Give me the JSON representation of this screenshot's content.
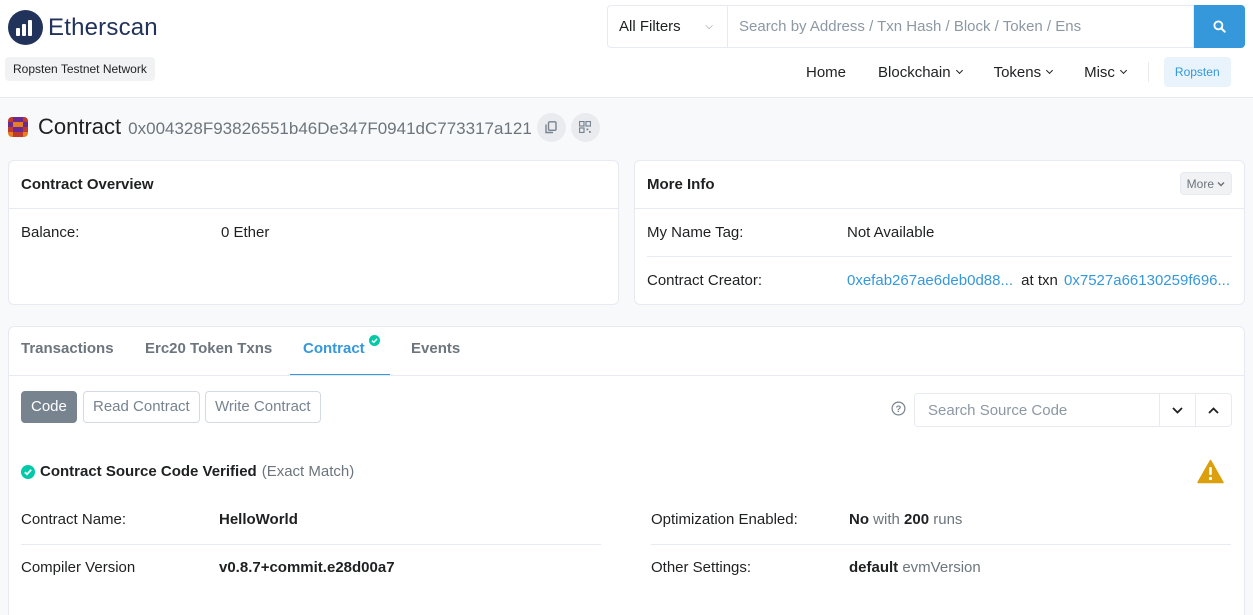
{
  "brand": {
    "name": "Etherscan",
    "network_badge": "Ropsten Testnet Network"
  },
  "search": {
    "filter_label": "All Filters",
    "placeholder": "Search by Address / Txn Hash / Block / Token / Ens"
  },
  "nav": {
    "items": [
      {
        "label": "Home",
        "dropdown": false
      },
      {
        "label": "Blockchain",
        "dropdown": true
      },
      {
        "label": "Tokens",
        "dropdown": true
      },
      {
        "label": "Misc",
        "dropdown": true
      }
    ],
    "network_button": "Ropsten"
  },
  "page": {
    "title": "Contract",
    "address": "0x004328F93826551b46De347F0941dC773317a121"
  },
  "overview": {
    "title": "Contract Overview",
    "balance_label": "Balance:",
    "balance_value": "0 Ether"
  },
  "more_info": {
    "title": "More Info",
    "more_button": "More",
    "name_tag_label": "My Name Tag:",
    "name_tag_value": "Not Available",
    "creator_label": "Contract Creator:",
    "creator_address": "0xefab267ae6deb0d88...",
    "at_txn": "at txn",
    "creator_txn": "0x7527a66130259f696..."
  },
  "tabs": [
    {
      "label": "Transactions",
      "active": false
    },
    {
      "label": "Erc20 Token Txns",
      "active": false
    },
    {
      "label": "Contract",
      "active": true,
      "verified": true
    },
    {
      "label": "Events",
      "active": false
    }
  ],
  "code_buttons": [
    {
      "label": "Code",
      "active": true
    },
    {
      "label": "Read Contract",
      "active": false
    },
    {
      "label": "Write Contract",
      "active": false
    }
  ],
  "source_search": {
    "placeholder": "Search Source Code"
  },
  "verification": {
    "title": "Contract Source Code Verified",
    "match": "(Exact Match)"
  },
  "contract_details": {
    "name_label": "Contract Name:",
    "name_value": "HelloWorld",
    "compiler_label": "Compiler Version",
    "compiler_value": "v0.8.7+commit.e28d00a7",
    "optimization_label": "Optimization Enabled:",
    "optimization_value": "No",
    "optimization_with": "with",
    "optimization_runs": "200",
    "optimization_runs_suffix": "runs",
    "settings_label": "Other Settings:",
    "settings_value": "default",
    "settings_suffix": "evmVersion"
  },
  "colors": {
    "accent": "#3498db",
    "brand_navy": "#21325b",
    "verified_green": "#00c9a7",
    "warning": "#dc9f0d"
  }
}
